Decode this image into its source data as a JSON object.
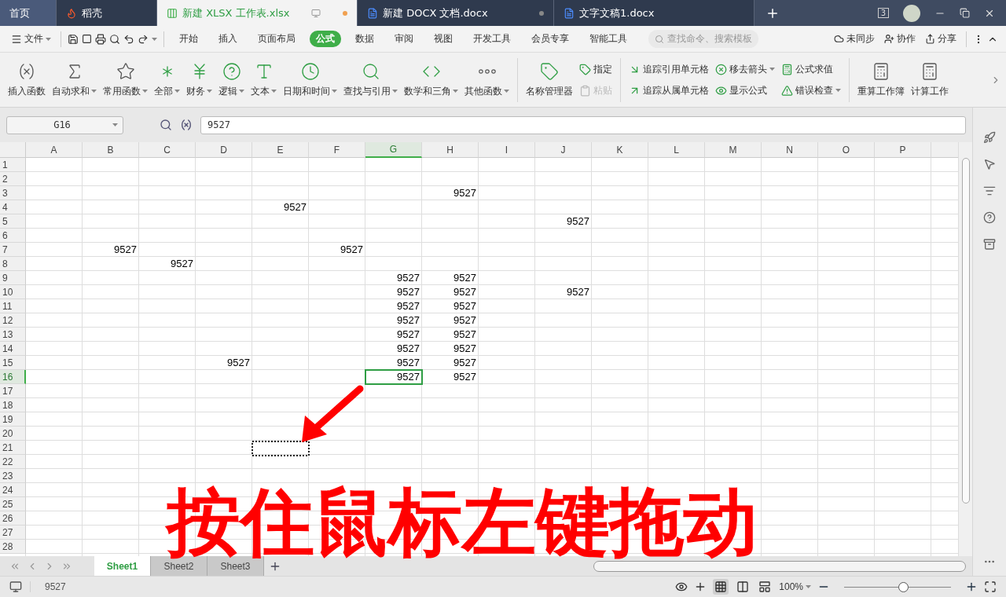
{
  "tabs": [
    {
      "label": "首页",
      "selected": false,
      "kind": "home"
    },
    {
      "label": "稻壳",
      "selected": false,
      "kind": "docer"
    },
    {
      "label": "新建 XLSX 工作表.xlsx",
      "selected": true,
      "kind": "sheet",
      "unsaved": true
    },
    {
      "label": "新建 DOCX 文档.docx",
      "selected": false,
      "kind": "doc",
      "unsaved": false
    },
    {
      "label": "文字文稿1.docx",
      "selected": false,
      "kind": "doc"
    }
  ],
  "window_badge": "3",
  "menu": {
    "file": "文件",
    "tabs": [
      {
        "label": "开始",
        "selected": false
      },
      {
        "label": "插入",
        "selected": false
      },
      {
        "label": "页面布局",
        "selected": false
      },
      {
        "label": "公式",
        "selected": true
      },
      {
        "label": "数据",
        "selected": false
      },
      {
        "label": "审阅",
        "selected": false
      },
      {
        "label": "视图",
        "selected": false
      },
      {
        "label": "开发工具",
        "selected": false
      },
      {
        "label": "会员专享",
        "selected": false
      },
      {
        "label": "智能工具",
        "selected": false
      }
    ],
    "search": {
      "placeholder": "查找命令、搜索模板"
    },
    "actions": [
      "未同步",
      "协作",
      "分享"
    ]
  },
  "ribbon": {
    "functions": [
      {
        "label": "插入函数",
        "dropdown": false
      },
      {
        "label": "自动求和",
        "dropdown": true
      },
      {
        "label": "常用函数",
        "dropdown": true
      },
      {
        "label": "全部",
        "dropdown": true
      },
      {
        "label": "财务",
        "dropdown": true
      },
      {
        "label": "逻辑",
        "dropdown": true
      },
      {
        "label": "文本",
        "dropdown": true
      },
      {
        "label": "日期和时间",
        "dropdown": true
      },
      {
        "label": "查找与引用",
        "dropdown": true
      },
      {
        "label": "数学和三角",
        "dropdown": true
      },
      {
        "label": "其他函数",
        "dropdown": true
      }
    ],
    "name_manager": "名称管理器",
    "small": [
      {
        "label": "指定",
        "disabled": false,
        "dropdown": false
      },
      {
        "label": "粘贴",
        "disabled": true,
        "dropdown": false
      },
      {
        "label": "追踪引用单元格",
        "disabled": false,
        "dropdown": false
      },
      {
        "label": "追踪从属单元格",
        "disabled": false,
        "dropdown": false
      },
      {
        "label": "移去箭头",
        "disabled": false,
        "dropdown": true
      },
      {
        "label": "显示公式",
        "disabled": false,
        "dropdown": false
      },
      {
        "label": "公式求值",
        "disabled": false,
        "dropdown": false
      },
      {
        "label": "错误检查",
        "disabled": false,
        "dropdown": true
      }
    ],
    "calc": [
      "重算工作簿",
      "计算工作"
    ]
  },
  "formula_bar": {
    "name_box": "G16",
    "value": "9527"
  },
  "columns": [
    {
      "label": "A",
      "selected": false
    },
    {
      "label": "B",
      "selected": false
    },
    {
      "label": "C",
      "selected": false
    },
    {
      "label": "D",
      "selected": false
    },
    {
      "label": "E",
      "selected": false
    },
    {
      "label": "F",
      "selected": false
    },
    {
      "label": "G",
      "selected": true
    },
    {
      "label": "H",
      "selected": false
    },
    {
      "label": "I",
      "selected": false
    },
    {
      "label": "J",
      "selected": false
    },
    {
      "label": "K",
      "selected": false
    },
    {
      "label": "L",
      "selected": false
    },
    {
      "label": "M",
      "selected": false
    },
    {
      "label": "N",
      "selected": false
    },
    {
      "label": "O",
      "selected": false
    },
    {
      "label": "P",
      "selected": false
    }
  ],
  "rows": [
    {
      "label": "1",
      "selected": false,
      "cells": []
    },
    {
      "label": "2",
      "selected": false,
      "cells": []
    },
    {
      "label": "3",
      "selected": false,
      "cells": [
        null,
        null,
        null,
        null,
        null,
        null,
        null,
        "9527"
      ]
    },
    {
      "label": "4",
      "selected": false,
      "cells": [
        null,
        null,
        null,
        null,
        "9527"
      ]
    },
    {
      "label": "5",
      "selected": false,
      "cells": [
        null,
        null,
        null,
        null,
        null,
        null,
        null,
        null,
        null,
        "9527"
      ]
    },
    {
      "label": "6",
      "selected": false,
      "cells": []
    },
    {
      "label": "7",
      "selected": false,
      "cells": [
        null,
        "9527",
        null,
        null,
        null,
        "9527"
      ]
    },
    {
      "label": "8",
      "selected": false,
      "cells": [
        null,
        null,
        "9527"
      ]
    },
    {
      "label": "9",
      "selected": false,
      "cells": [
        null,
        null,
        null,
        null,
        null,
        null,
        "9527",
        "9527"
      ]
    },
    {
      "label": "10",
      "selected": false,
      "cells": [
        null,
        null,
        null,
        null,
        null,
        null,
        "9527",
        "9527",
        null,
        "9527"
      ]
    },
    {
      "label": "11",
      "selected": false,
      "cells": [
        null,
        null,
        null,
        null,
        null,
        null,
        "9527",
        "9527"
      ]
    },
    {
      "label": "12",
      "selected": false,
      "cells": [
        null,
        null,
        null,
        null,
        null,
        null,
        "9527",
        "9527"
      ]
    },
    {
      "label": "13",
      "selected": false,
      "cells": [
        null,
        null,
        null,
        null,
        null,
        null,
        "9527",
        "9527"
      ]
    },
    {
      "label": "14",
      "selected": false,
      "cells": [
        null,
        null,
        null,
        null,
        null,
        null,
        "9527",
        "9527"
      ]
    },
    {
      "label": "15",
      "selected": false,
      "cells": [
        null,
        null,
        null,
        "9527",
        null,
        null,
        "9527",
        "9527"
      ]
    },
    {
      "label": "16",
      "selected": true,
      "cells": [
        null,
        null,
        null,
        null,
        null,
        null,
        "9527",
        "9527"
      ]
    },
    {
      "label": "17",
      "selected": false,
      "cells": []
    },
    {
      "label": "18",
      "selected": false,
      "cells": []
    },
    {
      "label": "19",
      "selected": false,
      "cells": []
    },
    {
      "label": "20",
      "selected": false,
      "cells": []
    },
    {
      "label": "21",
      "selected": false,
      "cells": []
    },
    {
      "label": "22",
      "selected": false,
      "cells": []
    },
    {
      "label": "23",
      "selected": false,
      "cells": []
    },
    {
      "label": "24",
      "selected": false,
      "cells": []
    },
    {
      "label": "25",
      "selected": false,
      "cells": []
    },
    {
      "label": "26",
      "selected": false,
      "cells": []
    },
    {
      "label": "27",
      "selected": false,
      "cells": []
    },
    {
      "label": "28",
      "selected": false,
      "cells": []
    }
  ],
  "annotation": {
    "caption": "按住鼠标左键拖动"
  },
  "sheets": [
    {
      "label": "Sheet1",
      "selected": true
    },
    {
      "label": "Sheet2",
      "selected": false
    },
    {
      "label": "Sheet3",
      "selected": false
    }
  ],
  "status_bar": {
    "value": "9527",
    "zoom": "100%",
    "zoom_slider": {
      "level": 0.55
    }
  }
}
